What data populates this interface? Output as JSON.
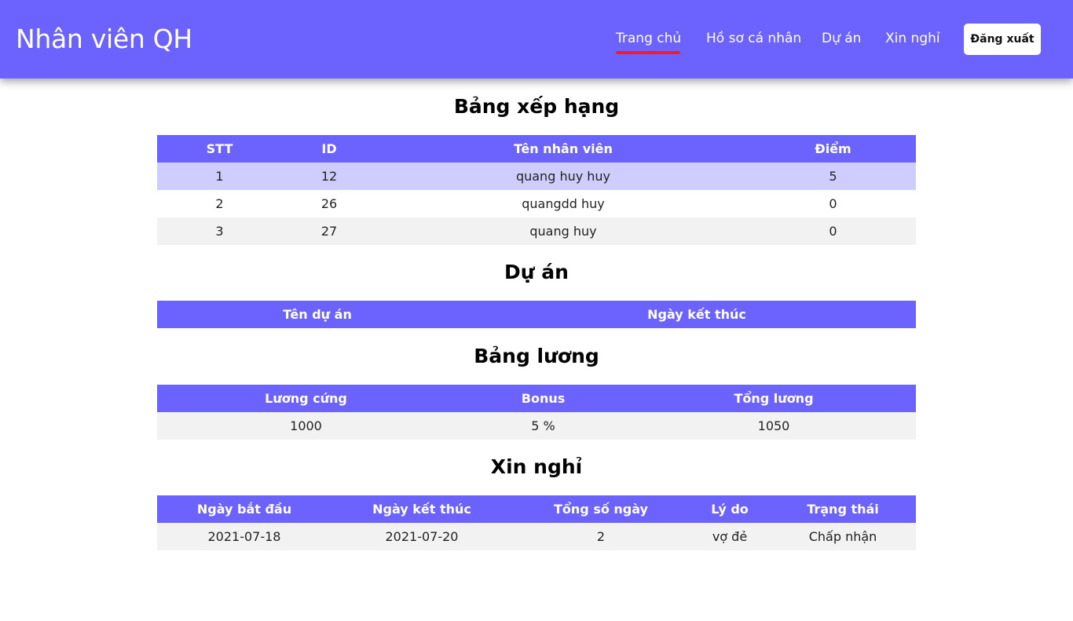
{
  "brand": "Nhân viên QH",
  "nav": {
    "items": [
      "Trang chủ",
      "Hồ sơ cá nhân",
      "Dự án",
      "Xin nghỉ"
    ],
    "active": "Trang chủ",
    "logout": "Đăng xuất"
  },
  "ranking": {
    "title": "Bảng xếp hạng",
    "headers": [
      "STT",
      "ID",
      "Tên nhân viên",
      "Điểm"
    ],
    "rows": [
      [
        "1",
        "12",
        "quang huy huy",
        "5"
      ],
      [
        "2",
        "26",
        "quangdd huy",
        "0"
      ],
      [
        "3",
        "27",
        "quang huy",
        "0"
      ]
    ]
  },
  "projects": {
    "title": "Dự án",
    "headers": [
      "Tên dự án",
      "Ngày kết thúc"
    ]
  },
  "salary": {
    "title": "Bảng lương",
    "headers": [
      "Lương cứng",
      "Bonus",
      "Tổng lương"
    ],
    "rows": [
      [
        "1000",
        "5 %",
        "1050"
      ]
    ]
  },
  "leave": {
    "title": "Xin nghỉ",
    "headers": [
      "Ngày bắt đầu",
      "Ngày kết thúc",
      "Tổng số ngày",
      "Lý do",
      "Trạng thái"
    ],
    "rows": [
      [
        "2021-07-18",
        "2021-07-20",
        "2",
        "vợ đẻ",
        "Chấp nhận"
      ]
    ]
  },
  "colors": {
    "primary": "#6c63ff",
    "active_underline": "#ff1a1a",
    "highlight_row": "#cfcdfd",
    "alt_row": "#f2f2f2"
  }
}
